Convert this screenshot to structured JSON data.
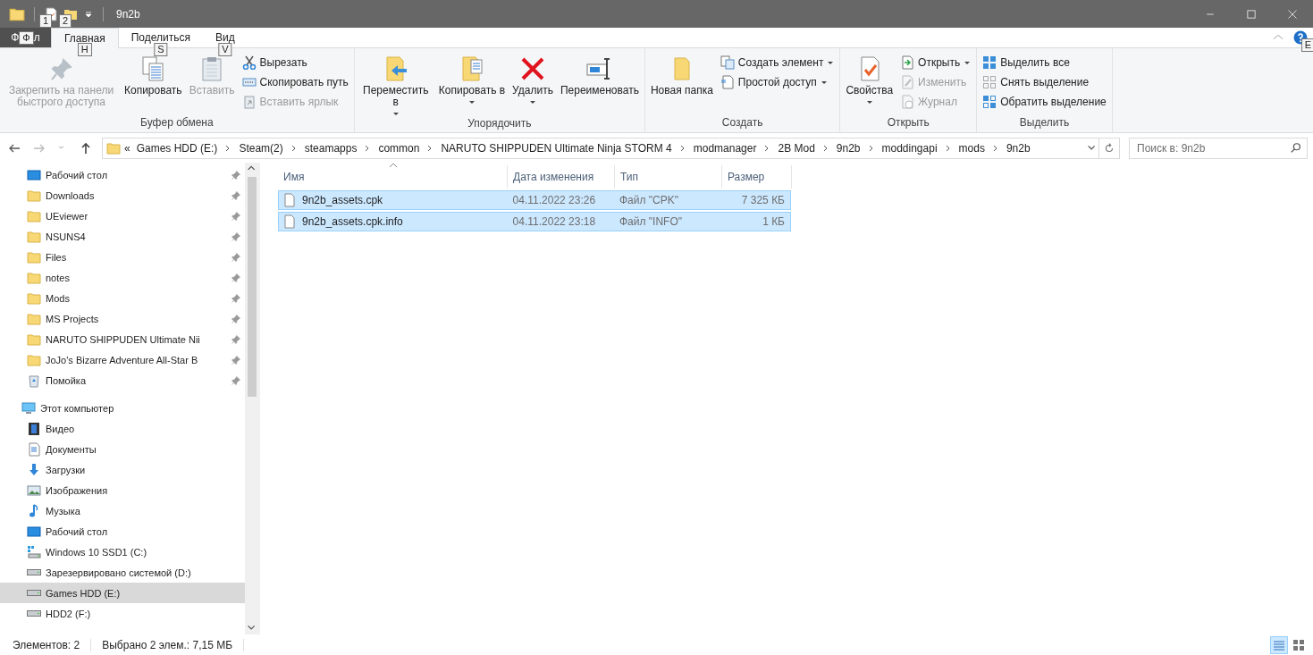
{
  "window": {
    "title": "9n2b",
    "quick_access_keytips": [
      "1",
      "2"
    ]
  },
  "file_tab": {
    "label_start": "Ф",
    "keytip": "Ф",
    "label_end": "л"
  },
  "ribbon_tabs": [
    {
      "label": "Главная",
      "selected": true,
      "keytip": "H"
    },
    {
      "label": "Поделиться",
      "selected": false,
      "keytip": "S"
    },
    {
      "label": "Вид",
      "selected": false,
      "keytip": "V"
    }
  ],
  "help_keytip": "E",
  "ribbon_groups": [
    {
      "label": "Буфер обмена",
      "items": [
        {
          "kind": "large",
          "label": "Закрепить на панели быстрого доступа",
          "dropdown": false,
          "disabled": true
        },
        {
          "kind": "large",
          "label": "Копировать",
          "dropdown": false,
          "disabled": false
        },
        {
          "kind": "large",
          "label": "Вставить",
          "dropdown": false,
          "disabled": true
        },
        {
          "kind": "stack",
          "buttons": [
            {
              "label": "Вырезать",
              "dropdown": false,
              "disabled": false
            },
            {
              "label": "Скопировать путь",
              "dropdown": false,
              "disabled": false
            },
            {
              "label": "Вставить ярлык",
              "dropdown": false,
              "disabled": true
            }
          ]
        }
      ]
    },
    {
      "label": "Упорядочить",
      "items": [
        {
          "kind": "large",
          "label": "Переместить в",
          "dropdown": true,
          "disabled": false
        },
        {
          "kind": "large",
          "label": "Копировать в",
          "dropdown": true,
          "disabled": false
        },
        {
          "kind": "large",
          "label": "Удалить",
          "dropdown": true,
          "disabled": false
        },
        {
          "kind": "large",
          "label": "Переименовать",
          "dropdown": false,
          "disabled": false
        }
      ]
    },
    {
      "label": "Создать",
      "items": [
        {
          "kind": "large",
          "label": "Новая папка",
          "dropdown": false,
          "disabled": false
        },
        {
          "kind": "stack",
          "buttons": [
            {
              "label": "Создать элемент",
              "dropdown": true,
              "disabled": false
            },
            {
              "label": "Простой доступ",
              "dropdown": true,
              "disabled": false
            }
          ]
        }
      ]
    },
    {
      "label": "Открыть",
      "items": [
        {
          "kind": "large",
          "label": "Свойства",
          "dropdown": true,
          "disabled": false
        },
        {
          "kind": "stack",
          "buttons": [
            {
              "label": "Открыть",
              "dropdown": true,
              "disabled": false
            },
            {
              "label": "Изменить",
              "dropdown": false,
              "disabled": true
            },
            {
              "label": "Журнал",
              "dropdown": false,
              "disabled": true
            }
          ]
        }
      ]
    },
    {
      "label": "Выделить",
      "items": [
        {
          "kind": "stack",
          "buttons": [
            {
              "label": "Выделить все",
              "dropdown": false,
              "disabled": false
            },
            {
              "label": "Снять выделение",
              "dropdown": false,
              "disabled": false
            },
            {
              "label": "Обратить выделение",
              "dropdown": false,
              "disabled": false
            }
          ]
        }
      ]
    }
  ],
  "address": {
    "overflow": "«",
    "path": [
      "Games HDD (E:)",
      "Steam(2)",
      "steamapps",
      "common",
      "NARUTO SHIPPUDEN Ultimate Ninja STORM 4",
      "modmanager",
      "2B Mod",
      "9n2b",
      "moddingapi",
      "mods",
      "9n2b"
    ]
  },
  "search": {
    "placeholder": "Поиск в: 9n2b"
  },
  "sidebar": {
    "items": [
      {
        "label": "Рабочий стол",
        "pinned": true,
        "selected": false
      },
      {
        "label": "Downloads",
        "pinned": true,
        "selected": false
      },
      {
        "label": "UEviewer",
        "pinned": true,
        "selected": false
      },
      {
        "label": "NSUNS4",
        "pinned": true,
        "selected": false
      },
      {
        "label": "Files",
        "pinned": true,
        "selected": false
      },
      {
        "label": "notes",
        "pinned": true,
        "selected": false
      },
      {
        "label": "Mods",
        "pinned": true,
        "selected": false
      },
      {
        "label": "MS Projects",
        "pinned": true,
        "selected": false
      },
      {
        "label": "NARUTO SHIPPUDEN Ultimate Nii",
        "pinned": true,
        "selected": false
      },
      {
        "label": "JoJo's Bizarre Adventure All-Star B",
        "pinned": true,
        "selected": false
      },
      {
        "label": "Помойка",
        "pinned": true,
        "selected": false
      },
      {
        "label": "Этот компьютер",
        "pinned": false,
        "selected": false,
        "children": [
          {
            "label": "Видео",
            "selected": false
          },
          {
            "label": "Документы",
            "selected": false
          },
          {
            "label": "Загрузки",
            "selected": false
          },
          {
            "label": "Изображения",
            "selected": false
          },
          {
            "label": "Музыка",
            "selected": false
          },
          {
            "label": "Рабочий стол",
            "selected": false
          },
          {
            "label": "Windows 10 SSD1 (C:)",
            "selected": false
          },
          {
            "label": "Зарезервировано системой (D:)",
            "selected": false
          },
          {
            "label": "Games HDD (E:)",
            "selected": true
          },
          {
            "label": "HDD2 (F:)",
            "selected": false
          }
        ]
      }
    ]
  },
  "table": {
    "columns": [
      {
        "label": "Имя",
        "sorted": true
      },
      {
        "label": "Дата изменения",
        "sorted": false
      },
      {
        "label": "Тип",
        "sorted": false
      },
      {
        "label": "Размер",
        "sorted": false
      }
    ],
    "rows": [
      {
        "cells": [
          "9n2b_assets.cpk",
          "04.11.2022 23:26",
          "Файл \"CPK\"",
          "7 325 КБ"
        ],
        "selected": true
      },
      {
        "cells": [
          "9n2b_assets.cpk.info",
          "04.11.2022 23:18",
          "Файл \"INFO\"",
          "1 КБ"
        ],
        "selected": true
      }
    ]
  },
  "status_bar": {
    "items": [
      "Элементов: 2",
      "Выбрано 2 элем.: 7,15 МБ"
    ],
    "views": [
      {
        "selected": true
      },
      {
        "selected": false
      }
    ]
  }
}
